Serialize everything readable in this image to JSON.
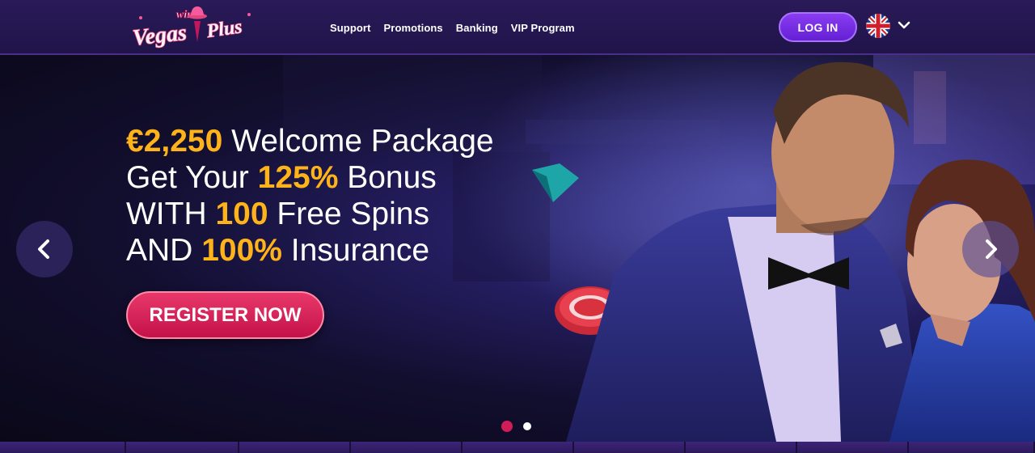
{
  "brand": {
    "logo_top": "win",
    "logo_main": "Vegas",
    "logo_accent": "Plus",
    "colors": {
      "pink": "#f45a9c",
      "cream": "#fff2f6",
      "purple": "#2a1a58"
    }
  },
  "nav": {
    "items": [
      "Support",
      "Promotions",
      "Banking",
      "VIP Program"
    ]
  },
  "header": {
    "login_label": "LOG IN",
    "language_icon": "uk-flag-icon",
    "language_chevron": "chevron-down-icon"
  },
  "hero": {
    "lines": [
      {
        "highlight": "€2,250",
        "rest": " Welcome Package"
      },
      {
        "lead": "Get Your ",
        "highlight": "125%",
        "rest": " Bonus"
      },
      {
        "lead": "WITH ",
        "highlight": "100",
        "rest": " Free Spins"
      },
      {
        "lead": "AND ",
        "highlight": "100%",
        "rest": " Insurance"
      }
    ],
    "register_label": "REGISTER NOW",
    "prev_icon": "chevron-left-icon",
    "next_icon": "chevron-right-icon",
    "slides": 2,
    "active_slide": 1,
    "colors": {
      "highlight": "#ffb31a",
      "register": "#d11d57",
      "login": "#7a30e6"
    }
  },
  "category_strip": {
    "count": 9
  }
}
